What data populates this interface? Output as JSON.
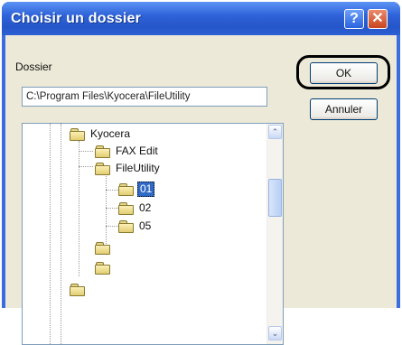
{
  "window": {
    "title": "Choisir un dossier",
    "help_glyph": "?",
    "close_glyph": "✕"
  },
  "folder_label": "Dossier",
  "path_value": "C:\\Program Files\\Kyocera\\FileUtility",
  "buttons": {
    "ok": "OK",
    "cancel": "Annuler"
  },
  "tree": {
    "items": [
      {
        "label": "Kyocera"
      },
      {
        "label": "FAX Edit"
      },
      {
        "label": "FileUtility"
      },
      {
        "label": "01",
        "selected": true
      },
      {
        "label": "02"
      },
      {
        "label": "05"
      },
      {
        "label": ""
      },
      {
        "label": ""
      },
      {
        "label": ""
      }
    ]
  },
  "scroll": {
    "up_glyph": "⌃",
    "down_glyph": "⌄"
  }
}
